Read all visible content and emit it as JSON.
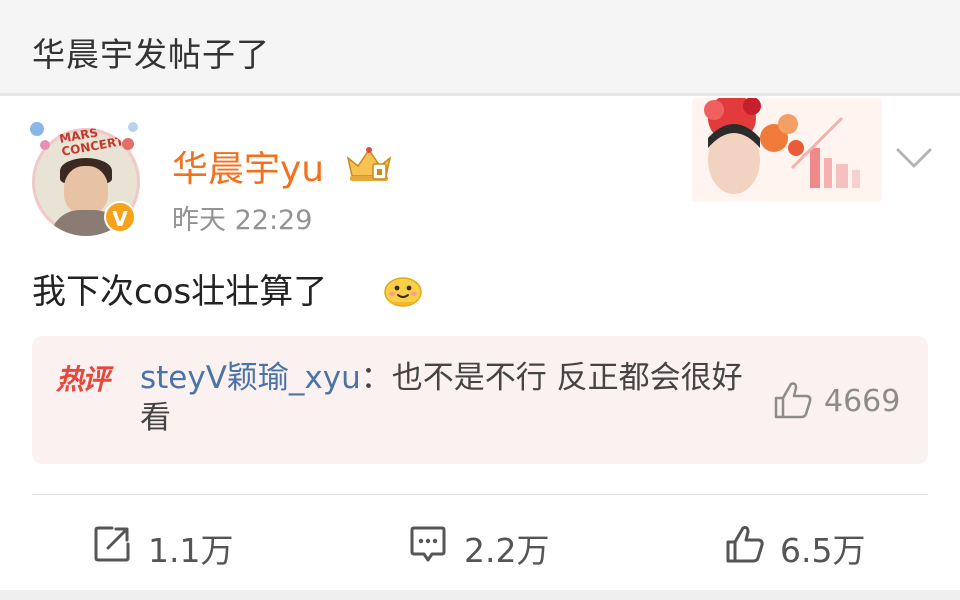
{
  "header": {
    "title": "华晨宇发帖子了"
  },
  "post": {
    "author": {
      "name": "华晨宇yu",
      "verified_badge": "V",
      "avatar_logo_text": "MARS CONCERT"
    },
    "time": "昨天 22:29",
    "content": "我下次cos壮壮算了",
    "content_emoji": "emoji-face",
    "hot_comment": {
      "tag": "热评",
      "commenter": "steyV颖瑜_xyu",
      "separator": "：",
      "text": "也不是不行 反正都会很好看",
      "likes": "4669"
    }
  },
  "actions": {
    "repost_count": "1.1万",
    "comment_count": "2.2万",
    "like_count": "6.5万"
  },
  "colors": {
    "accent_orange": "#f2711c",
    "hot_tag_red": "#e8473c",
    "commenter_blue": "#4a73a8",
    "hot_box_bg": "#fbf1f0"
  }
}
